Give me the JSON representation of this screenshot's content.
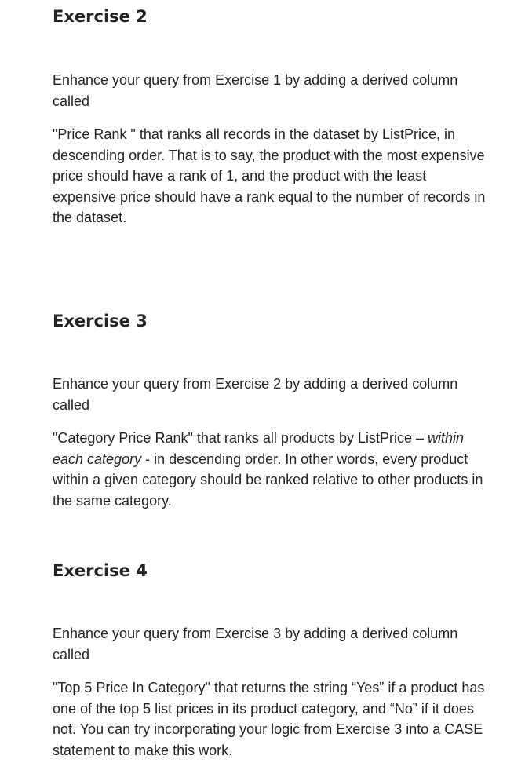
{
  "exercises": [
    {
      "heading": "Exercise 2",
      "intro": "Enhance your query from Exercise 1 by adding a derived column called",
      "body_before_italic": "\"Price Rank \" that ranks all records in the dataset by ListPrice, in descending order. That is to say, the product with the most expensive price should have a rank of 1, and the product with the least expensive price should have a rank equal to the number of records in the dataset.",
      "body_italic": "",
      "body_after_italic": ""
    },
    {
      "heading": "Exercise 3",
      "intro": "Enhance your query from Exercise 2 by adding a derived column called",
      "body_before_italic": "\"Category Price Rank\" that ranks all products by ListPrice – ",
      "body_italic": "within each category",
      "body_after_italic": " - in descending order. In other words, every product within a given category should be ranked relative to other products in the same category."
    },
    {
      "heading": "Exercise 4",
      "intro": "Enhance your query from Exercise 3 by adding a derived column called",
      "body_before_italic": "\"Top 5 Price In Category\" that returns the string “Yes” if a product has one of the top 5 list prices in its product category, and “No” if it does not. You can try incorporating your logic from Exercise 3 into a CASE statement to make this work.",
      "body_italic": "",
      "body_after_italic": ""
    }
  ]
}
